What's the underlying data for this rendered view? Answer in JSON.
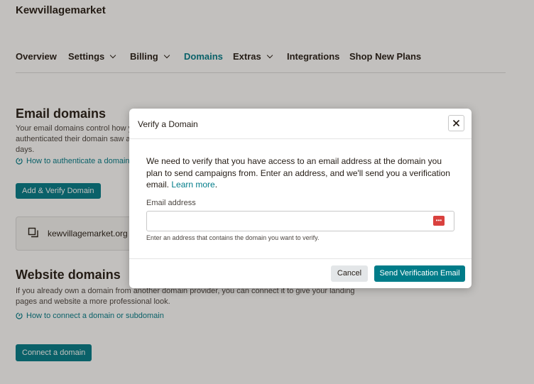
{
  "account": {
    "name": "Kewvillagemarket"
  },
  "nav": {
    "items": [
      {
        "label": "Overview"
      },
      {
        "label": "Settings"
      },
      {
        "label": "Billing"
      },
      {
        "label": "Domains"
      },
      {
        "label": "Extras"
      },
      {
        "label": "Integrations"
      },
      {
        "label": "Shop New Plans"
      }
    ],
    "active": "Domains"
  },
  "email_domains": {
    "title": "Email domains",
    "description_lines": [
      "Your email domains control how y",
      "authenticated their domain saw a",
      "days."
    ],
    "help_link": "How to authenticate a domain",
    "add_button": "Add & Verify Domain",
    "domain": "kewvillagemarket.org"
  },
  "website_domains": {
    "title": "Website domains",
    "description_lines": [
      "If you already own a domain from another domain provider, you can connect it to give your landing",
      "pages and website a more professional look."
    ],
    "help_link": "How to connect a domain or subdomain",
    "connect_button": "Connect a domain"
  },
  "modal": {
    "title": "Verify a Domain",
    "body": "We need to verify that you have access to an email address at the domain you plan to send campaigns from. Enter an address, and we'll send you a verification email.",
    "learn_more": "Learn more",
    "body_end": ".",
    "email_label": "Email address",
    "email_value": "",
    "email_hint": "Enter an address that contains the domain you want to verify.",
    "cancel": "Cancel",
    "send": "Send Verification Email"
  },
  "colors": {
    "accent": "#007c89",
    "text": "#241c15",
    "password_manager": "#d9413e"
  },
  "icons": {
    "nav_dropdown": "chevron-down-icon",
    "help": "help-circle-icon",
    "domain": "domain-copy-icon",
    "close": "close-icon",
    "password_manager": "password-manager-icon"
  }
}
